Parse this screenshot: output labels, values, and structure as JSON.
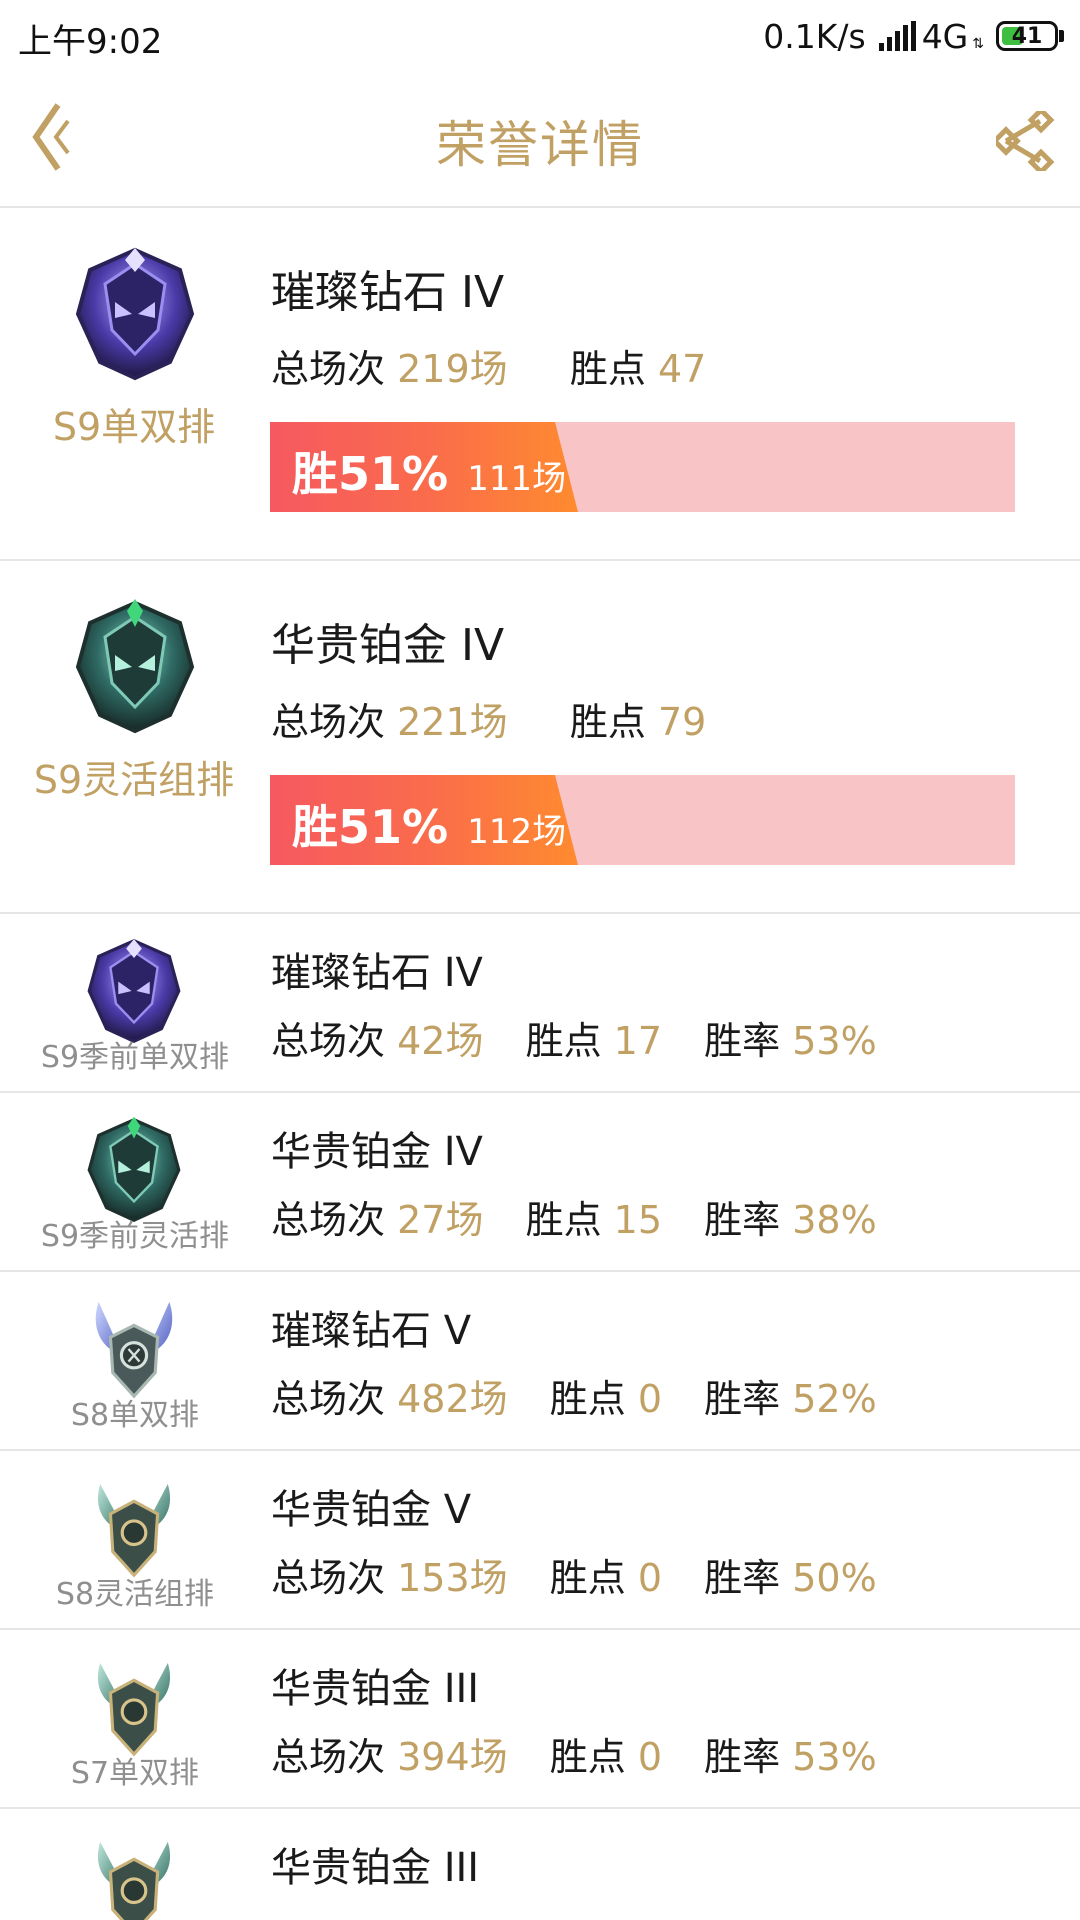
{
  "status": {
    "time": "上午9:02",
    "speed": "0.1K/s",
    "network": "4G",
    "battery": "41",
    "battery_level": 0.41
  },
  "header": {
    "title": "荣誉详情",
    "back_icon": "chevron-left-icon",
    "share_icon": "share-icon"
  },
  "colors": {
    "accent_gold": "#c1a064",
    "bar_bg": "#f8c4c6",
    "bar_start": "#f65960",
    "bar_end": "#ff8b2f"
  },
  "big_cards": [
    {
      "queue": "S9单双排",
      "rank": "璀璨钻石 IV",
      "total_label": "总场次",
      "total": "219场",
      "points_label": "胜点",
      "points": "47",
      "win_rate": "胜51%",
      "wins": "111场",
      "win_fraction": 0.51,
      "emblem": "diamond-emblem-icon"
    },
    {
      "queue": "S9灵活组排",
      "rank": "华贵铂金 IV",
      "total_label": "总场次",
      "total": "221场",
      "points_label": "胜点",
      "points": "79",
      "win_rate": "胜51%",
      "wins": "112场",
      "win_fraction": 0.51,
      "emblem": "platinum-emblem-icon"
    }
  ],
  "rows": [
    {
      "queue": "S9季前单双排",
      "rank": "璀璨钻石 IV",
      "total_label": "总场次",
      "total": "42场",
      "points_label": "胜点",
      "points": "17",
      "rate_label": "胜率",
      "rate": "53%",
      "emblem": "diamond-emblem-icon"
    },
    {
      "queue": "S9季前灵活排",
      "rank": "华贵铂金 IV",
      "total_label": "总场次",
      "total": "27场",
      "points_label": "胜点",
      "points": "15",
      "rate_label": "胜率",
      "rate": "38%",
      "emblem": "platinum-emblem-icon"
    },
    {
      "queue": "S8单双排",
      "rank": "璀璨钻石 V",
      "total_label": "总场次",
      "total": "482场",
      "points_label": "胜点",
      "points": "0",
      "rate_label": "胜率",
      "rate": "52%",
      "emblem": "diamond-winged-emblem-icon"
    },
    {
      "queue": "S8灵活组排",
      "rank": "华贵铂金 V",
      "total_label": "总场次",
      "total": "153场",
      "points_label": "胜点",
      "points": "0",
      "rate_label": "胜率",
      "rate": "50%",
      "emblem": "platinum-winged-emblem-icon"
    },
    {
      "queue": "S7单双排",
      "rank": "华贵铂金 III",
      "total_label": "总场次",
      "total": "394场",
      "points_label": "胜点",
      "points": "0",
      "rate_label": "胜率",
      "rate": "53%",
      "emblem": "platinum-winged-emblem-icon"
    },
    {
      "queue": "",
      "rank": "华贵铂金 III",
      "total_label": "",
      "total": "",
      "points_label": "",
      "points": "",
      "rate_label": "",
      "rate": "",
      "emblem": "platinum-winged-emblem-icon"
    }
  ]
}
